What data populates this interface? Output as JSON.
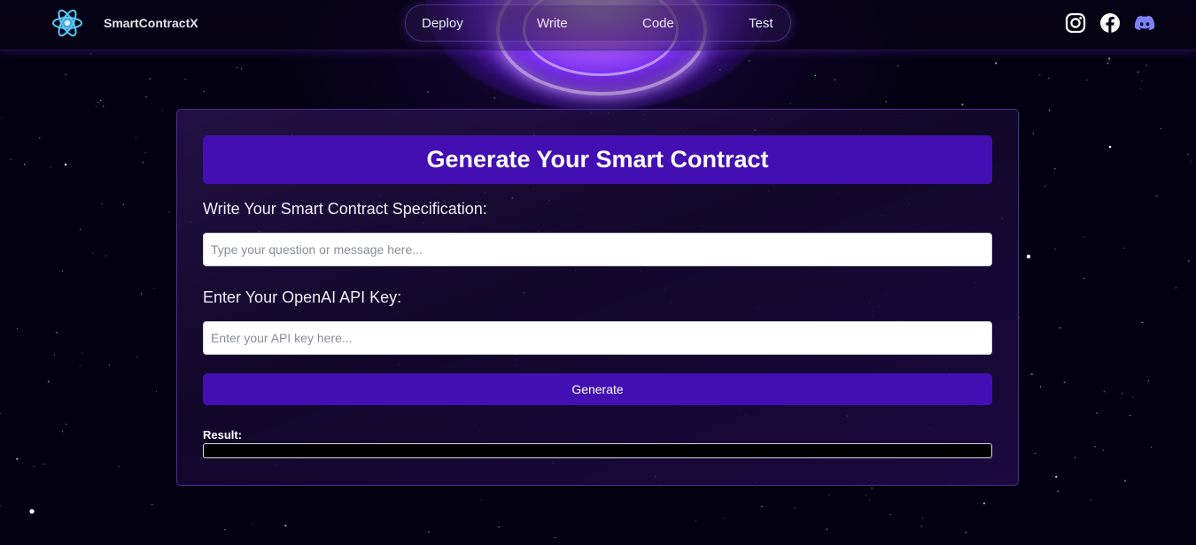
{
  "header": {
    "brand": "SmartContractX",
    "nav": [
      "Deploy",
      "Write",
      "Code",
      "Test"
    ],
    "social": [
      "instagram-icon",
      "facebook-icon",
      "discord-icon"
    ]
  },
  "form": {
    "title": "Generate Your Smart Contract",
    "spec_label": "Write Your Smart Contract Specification:",
    "spec_placeholder": "Type your question or message here...",
    "key_label": "Enter Your OpenAI API Key:",
    "key_placeholder": "Enter your API key here...",
    "generate_label": "Generate",
    "result_label": "Result:",
    "result_value": ""
  },
  "colors": {
    "accent": "#430fb3",
    "background": "#030111",
    "discord": "#7b83f5"
  }
}
